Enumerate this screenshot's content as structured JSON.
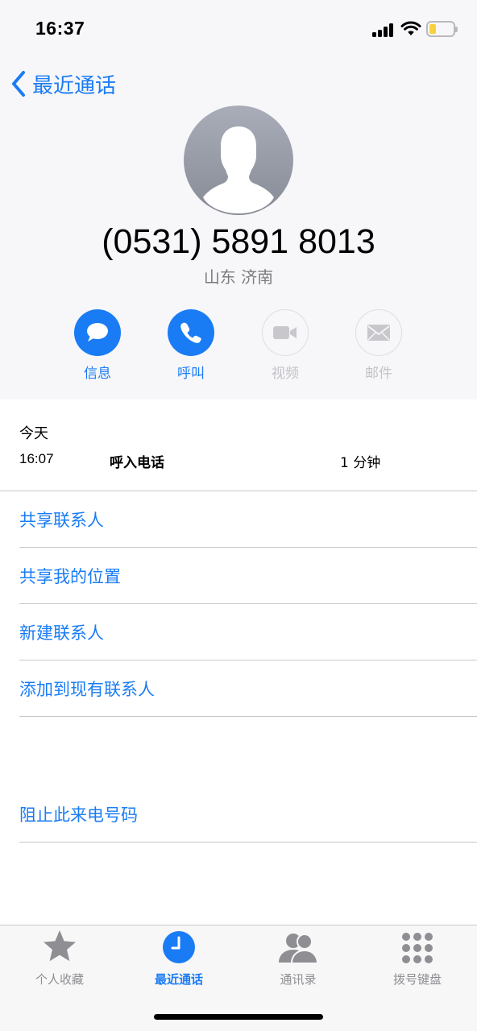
{
  "status_bar": {
    "time": "16:37"
  },
  "nav": {
    "back_label": "最近通话"
  },
  "contact": {
    "number": "(0531) 5891 8013",
    "location": "山东 济南"
  },
  "actions": [
    {
      "label": "信息",
      "icon": "message-bubble-icon",
      "enabled": true
    },
    {
      "label": "呼叫",
      "icon": "phone-icon",
      "enabled": true
    },
    {
      "label": "视频",
      "icon": "video-camera-icon",
      "enabled": false
    },
    {
      "label": "邮件",
      "icon": "mail-envelope-icon",
      "enabled": false
    }
  ],
  "call_log": {
    "day": "今天",
    "entries": [
      {
        "time": "16:07",
        "type": "呼入电话",
        "duration": "1 分钟"
      }
    ]
  },
  "options": [
    {
      "label": "共享联系人"
    },
    {
      "label": "共享我的位置"
    },
    {
      "label": "新建联系人"
    },
    {
      "label": "添加到现有联系人"
    }
  ],
  "block_option": {
    "label": "阻止此来电号码"
  },
  "tab_bar": {
    "tabs": [
      {
        "label": "个人收藏",
        "icon": "star-icon",
        "active": false
      },
      {
        "label": "最近通话",
        "icon": "clock-icon",
        "active": true
      },
      {
        "label": "通讯录",
        "icon": "contacts-icon",
        "active": false
      },
      {
        "label": "拨号键盘",
        "icon": "keypad-icon",
        "active": false
      }
    ]
  },
  "colors": {
    "accent": "#1a7cf4",
    "disabled": "#c2c2c7",
    "secondary_text": "#7c7c80",
    "header_background": "#f7f7fa"
  }
}
